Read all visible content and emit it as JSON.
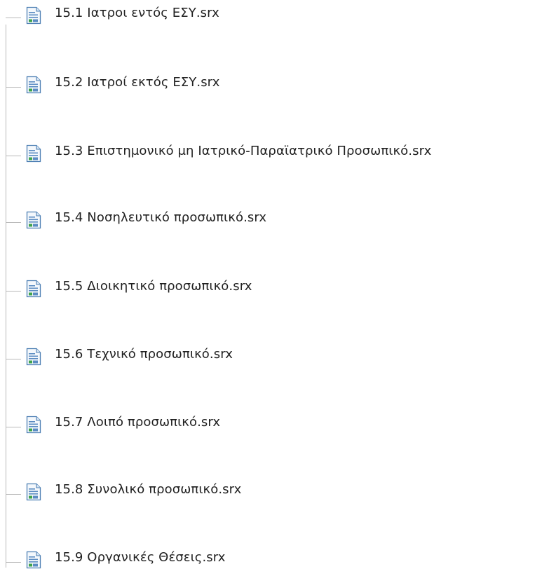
{
  "tree": {
    "items": [
      {
        "label": "15.1 Ιατροι εντός ΕΣΥ.srx",
        "icon": "report-file-icon"
      },
      {
        "label": "15.2 Ιατροί εκτός ΕΣΥ.srx",
        "icon": "report-file-icon"
      },
      {
        "label": "15.3 Επιστημονικό μη Ιατρικό-Παραϊατρικό Προσωπικό.srx",
        "icon": "report-file-icon"
      },
      {
        "label": "15.4 Νοσηλευτικό προσωπικό.srx",
        "icon": "report-file-icon"
      },
      {
        "label": "15.5 Διοικητικό προσωπικό.srx",
        "icon": "report-file-icon"
      },
      {
        "label": "15.6 Τεχνικό προσωπικό.srx",
        "icon": "report-file-icon"
      },
      {
        "label": "15.7 Λοιπό προσωπικό.srx",
        "icon": "report-file-icon"
      },
      {
        "label": "15.8 Συνολικό προσωπικό.srx",
        "icon": "report-file-icon"
      },
      {
        "label": "15.9 Οργανικές Θέσεις.srx",
        "icon": "report-file-icon"
      }
    ]
  }
}
